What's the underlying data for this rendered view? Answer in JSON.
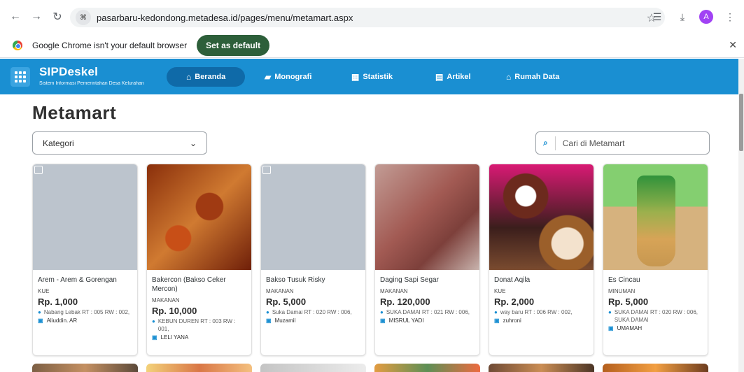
{
  "browser": {
    "url": "pasarbaru-kedondong.metadesa.id/pages/menu/metamart.aspx",
    "avatar": "A",
    "infobar_text": "Google Chrome isn't your default browser",
    "set_default": "Set as default"
  },
  "app": {
    "title": "SIPDeskel",
    "subtitle": "Sistem Informasi Pemerintahan Desa Kelurahan",
    "nav": [
      "Beranda",
      "Monografi",
      "Statistik",
      "Artikel",
      "Rumah Data"
    ]
  },
  "page": {
    "title": "Metamart",
    "category_placeholder": "Kategori",
    "search_placeholder": "Cari di Metamart"
  },
  "products": [
    {
      "name": "Arem - Arem & Gorengan",
      "category": "KUE",
      "price": "Rp. 1,000",
      "location": "Nabang Lebak RT : 005 RW : 002,",
      "seller": "Aliuddin. AR",
      "image": "placeholder"
    },
    {
      "name": "Bakercon (Bakso Ceker Mercon)",
      "category": "MAKANAN",
      "price": "Rp. 10,000",
      "location": "KEBUN DUREN RT : 003 RW : 001,",
      "seller": "LELI YANA",
      "image": "bakso-ceker"
    },
    {
      "name": "Bakso Tusuk Risky",
      "category": "MAKANAN",
      "price": "Rp. 5,000",
      "location": "Suka Damai RT : 020 RW : 006,",
      "seller": "Muzamil",
      "image": "placeholder"
    },
    {
      "name": "Daging Sapi Segar",
      "category": "MAKANAN",
      "price": "Rp. 120,000",
      "location": "SUKA DAMAI RT : 021 RW : 006,",
      "seller": "MISRUL YADI",
      "image": "daging"
    },
    {
      "name": "Donat Aqila",
      "category": "KUE",
      "price": "Rp. 2,000",
      "location": "way baru RT : 006 RW : 002,",
      "seller": "zuhroni",
      "image": "donat"
    },
    {
      "name": "Es Cincau",
      "category": "MINUMAN",
      "price": "Rp. 5,000",
      "location": "SUKA DAMAI RT : 020 RW : 006, SUKA DAMAI",
      "seller": "UMAMAH",
      "image": "cincau"
    }
  ],
  "icons": {
    "pin": "location-icon",
    "seller": "seller-icon",
    "search": "search-icon"
  },
  "colors": {
    "nav_bg": "#1a8fd2",
    "active_nav": "#0f6aa8",
    "button_green": "#2d5f3a"
  }
}
